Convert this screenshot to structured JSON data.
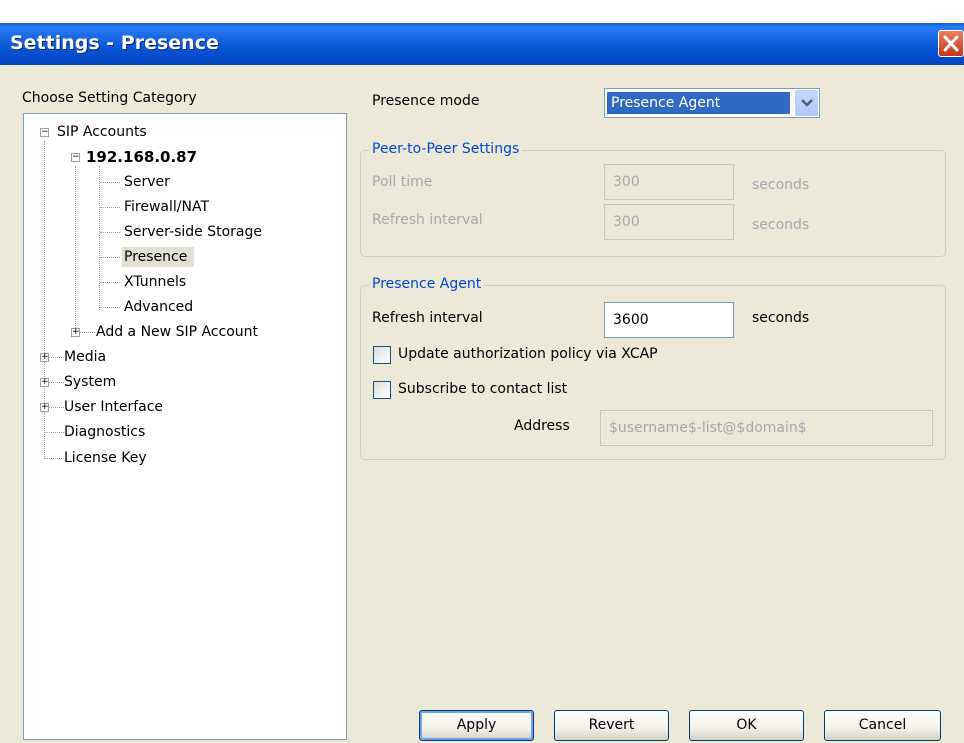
{
  "window": {
    "title": "Settings - Presence"
  },
  "tree": {
    "heading": "Choose Setting Category",
    "items": [
      {
        "label": "SIP Accounts",
        "expander": "−"
      },
      {
        "label": "192.168.0.87",
        "expander": "−"
      },
      {
        "label": "Server"
      },
      {
        "label": "Firewall/NAT"
      },
      {
        "label": "Server-side Storage"
      },
      {
        "label": "Presence",
        "selected": true
      },
      {
        "label": "XTunnels"
      },
      {
        "label": "Advanced"
      },
      {
        "label": "Add a New SIP Account",
        "expander": "+"
      },
      {
        "label": "Media",
        "expander": "+"
      },
      {
        "label": "System",
        "expander": "+"
      },
      {
        "label": "User Interface",
        "expander": "+"
      },
      {
        "label": "Diagnostics"
      },
      {
        "label": "License Key"
      }
    ]
  },
  "presence_mode": {
    "label": "Presence mode",
    "value": "Presence Agent"
  },
  "peer_to_peer": {
    "legend": "Peer-to-Peer Settings",
    "poll_time": {
      "label": "Poll time",
      "value": "300",
      "unit": "seconds"
    },
    "refresh_interval": {
      "label": "Refresh interval",
      "value": "300",
      "unit": "seconds"
    }
  },
  "presence_agent": {
    "legend": "Presence Agent",
    "refresh_interval": {
      "label": "Refresh interval",
      "value": "3600",
      "unit": "seconds"
    },
    "update_auth_policy": {
      "label": "Update authorization policy via XCAP",
      "checked": false
    },
    "subscribe_contact_list": {
      "label": "Subscribe to contact list",
      "checked": false
    },
    "address": {
      "label": "Address",
      "value": "$username$-list@$domain$"
    }
  },
  "buttons": {
    "apply": "Apply",
    "revert": "Revert",
    "ok": "OK",
    "cancel": "Cancel"
  },
  "icons": {
    "close": "close-icon",
    "dropdown": "chevron-down-icon",
    "expand": "plus-box-icon",
    "collapse": "minus-box-icon"
  },
  "colors": {
    "titlebar": "#0a5fde",
    "selection": "#316ac5",
    "legend": "#0046d5",
    "client_bg": "#ece9d8"
  }
}
